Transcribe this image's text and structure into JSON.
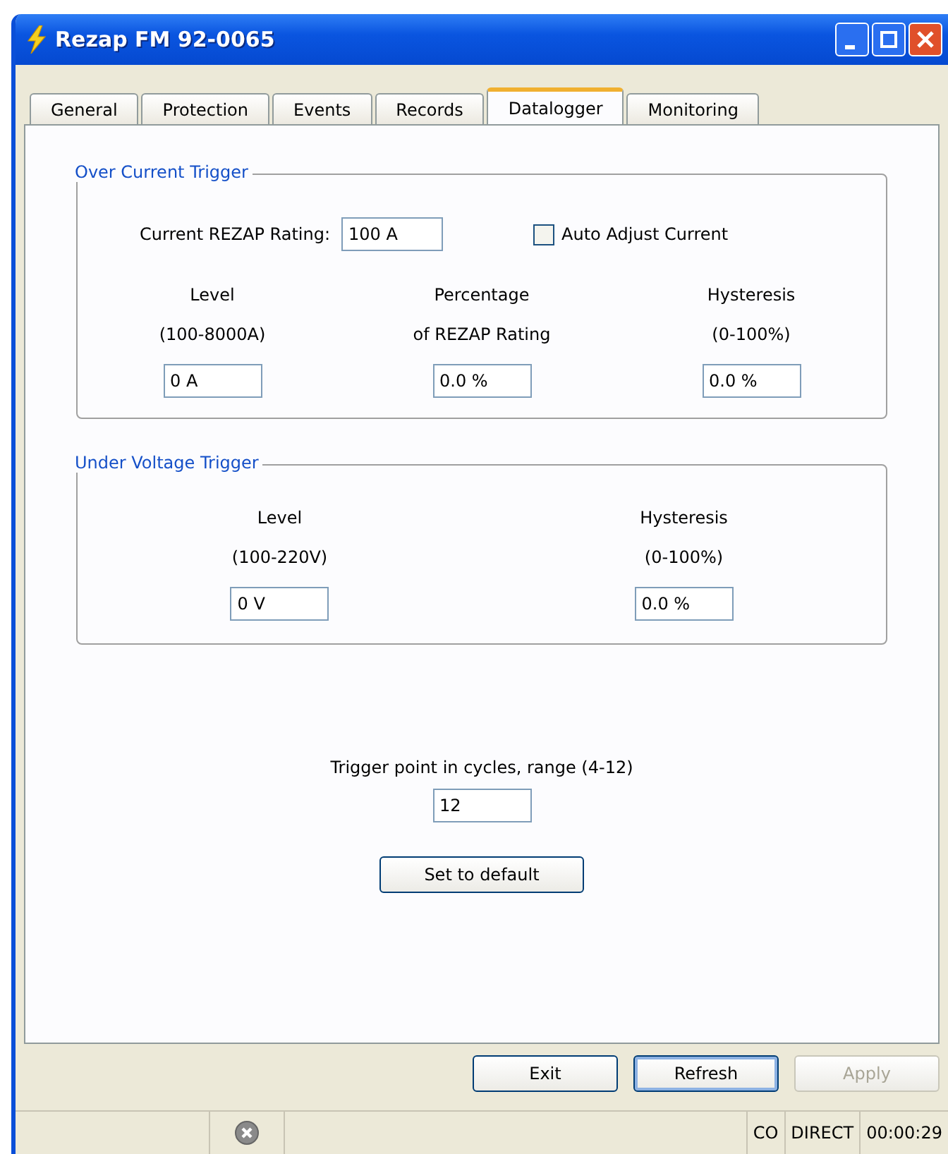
{
  "window": {
    "title": "Rezap FM 92-0065"
  },
  "tabs": [
    {
      "label": "General",
      "selected": false
    },
    {
      "label": "Protection",
      "selected": false
    },
    {
      "label": "Events",
      "selected": false
    },
    {
      "label": "Records",
      "selected": false
    },
    {
      "label": "Datalogger",
      "selected": true
    },
    {
      "label": "Monitoring",
      "selected": false
    }
  ],
  "over_current": {
    "title": "Over Current Trigger",
    "rating_label": "Current REZAP Rating:",
    "rating_value": "100 A",
    "auto_adjust": {
      "label": "Auto Adjust Current",
      "checked": false
    },
    "columns": [
      {
        "label": "Level",
        "range": "(100-8000A)",
        "value": "0 A"
      },
      {
        "label": "Percentage",
        "range": "of REZAP Rating",
        "value": "0.0 %"
      },
      {
        "label": "Hysteresis",
        "range": "(0-100%)",
        "value": "0.0 %"
      }
    ]
  },
  "under_voltage": {
    "title": "Under Voltage Trigger",
    "columns": [
      {
        "label": "Level",
        "range": "(100-220V)",
        "value": "0 V"
      },
      {
        "label": "Hysteresis",
        "range": "(0-100%)",
        "value": "0.0 %"
      }
    ]
  },
  "trigger": {
    "label": "Trigger point in cycles, range (4-12)",
    "value": "12"
  },
  "default_button": "Set to default",
  "buttons": [
    {
      "label": "Exit",
      "disabled": false,
      "focused": false
    },
    {
      "label": "Refresh",
      "disabled": false,
      "focused": true
    },
    {
      "label": "Apply",
      "disabled": true,
      "focused": false
    }
  ],
  "status_bar": {
    "error_icon": true,
    "cells": [
      "CO",
      "DIRECT",
      "00:00:29"
    ]
  }
}
